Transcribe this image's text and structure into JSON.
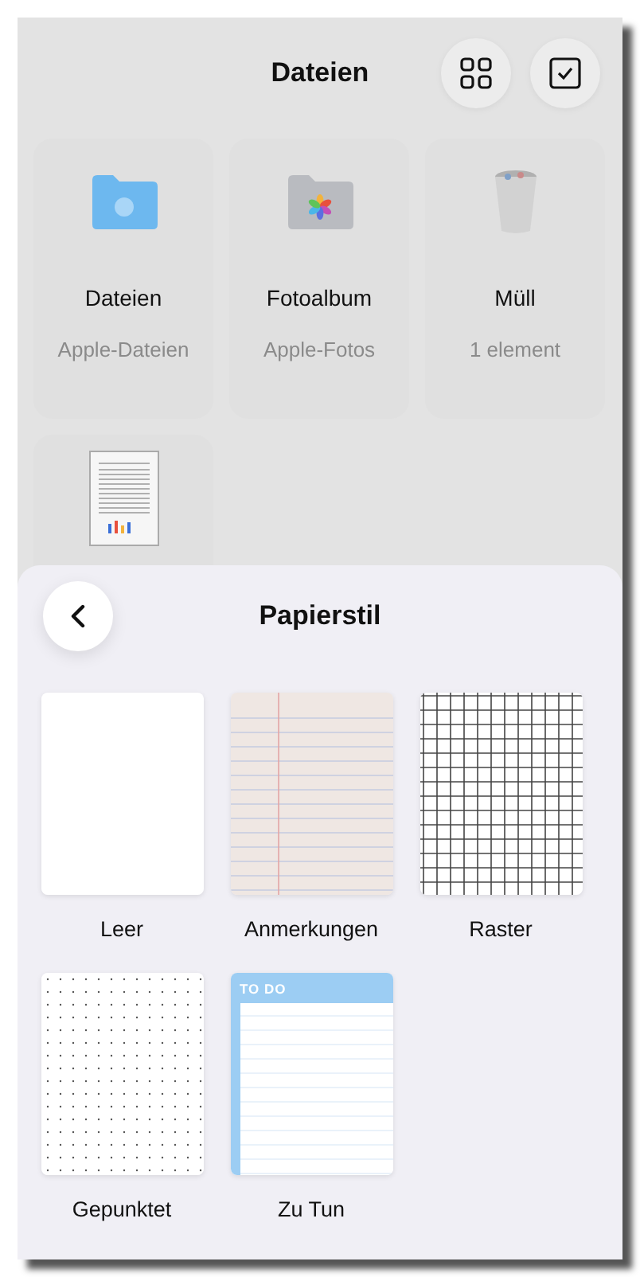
{
  "header": {
    "title": "Dateien"
  },
  "locations": [
    {
      "kind": "folder",
      "name": "Dateien",
      "subtitle": "Apple-Dateien"
    },
    {
      "kind": "photos",
      "name": "Fotoalbum",
      "subtitle": "Apple-Fotos"
    },
    {
      "kind": "trash",
      "name": "Müll",
      "subtitle": "1 element"
    },
    {
      "kind": "document"
    }
  ],
  "sheet": {
    "title": "Papierstil",
    "styles": [
      {
        "kind": "blank",
        "label": "Leer"
      },
      {
        "kind": "lined",
        "label": "Anmerkungen"
      },
      {
        "kind": "grid",
        "label": "Raster"
      },
      {
        "kind": "dotted",
        "label": "Gepunktet"
      },
      {
        "kind": "todo",
        "label": "Zu Tun",
        "header": "TO DO"
      }
    ]
  }
}
